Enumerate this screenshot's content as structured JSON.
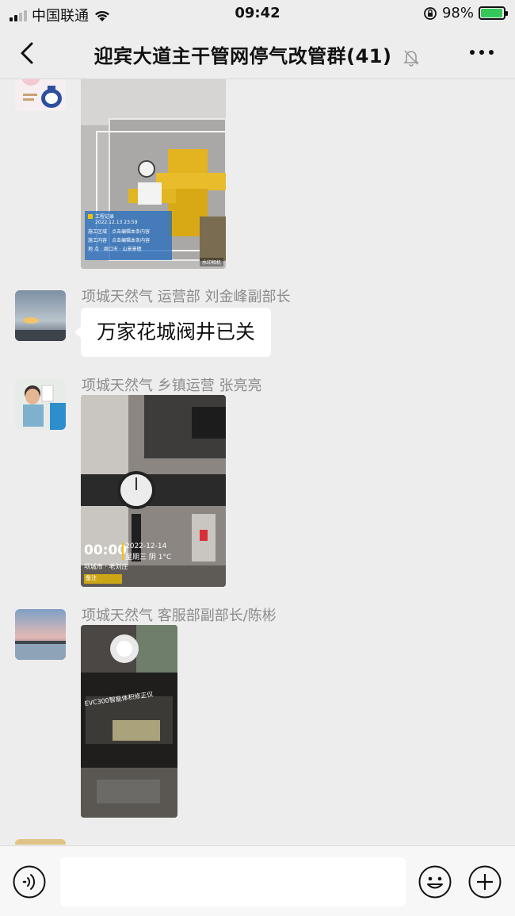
{
  "status_bar": {
    "carrier": "中国联通",
    "time": "09:42",
    "battery_percent": "98%",
    "battery_level": 0.98,
    "icons": [
      "signal-icon",
      "wifi-icon",
      "orientation-lock-icon",
      "battery-charging-icon"
    ]
  },
  "nav": {
    "title": "迎宾大道主干管网停气改管群(41)",
    "icons": [
      "back-chevron-icon",
      "mute-bell-icon",
      "more-icon"
    ]
  },
  "messages": [
    {
      "type": "image",
      "image": {
        "record_title": "工程记录",
        "record_date": "2022.12.13 23:59",
        "rows": [
          {
            "label": "施工区域",
            "value": "点击编辑本条内容"
          },
          {
            "label": "施工内容",
            "value": "点击编辑本条内容"
          },
          {
            "label": "地    点",
            "value": "周口市 · 山景景檐"
          }
        ],
        "watermark": "水印相机"
      }
    },
    {
      "type": "text",
      "sender": "项城天然气 运营部 刘金峰副部长",
      "text": "万家花城阀井已关"
    },
    {
      "type": "image",
      "sender": "项城天然气 乡镇运营 张亮亮",
      "image": {
        "time": "00:00",
        "date": "2022-12-14",
        "weather": "星期三 阴 1°C",
        "location": "项城市 · 老刘庄",
        "note": "备注"
      }
    },
    {
      "type": "image",
      "sender": "项城天然气 客服部副部长/陈彬",
      "image": {
        "device_label": "EVC300智能体积修正仪"
      }
    }
  ],
  "input_bar": {
    "placeholder": "",
    "icons": [
      "voice-icon",
      "emoji-icon",
      "plus-icon"
    ]
  }
}
